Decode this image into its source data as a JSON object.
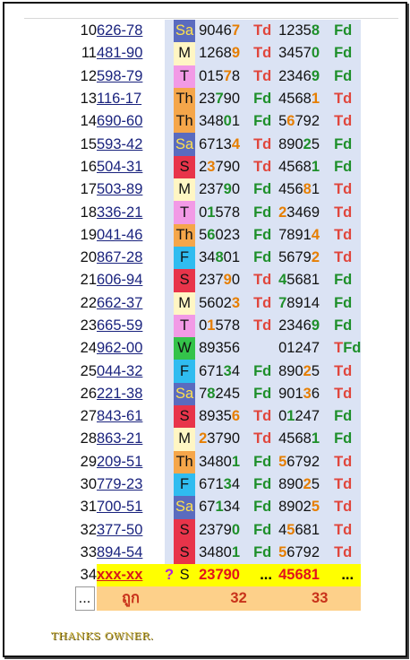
{
  "rows": [
    {
      "no": "10",
      "code": "626-78",
      "day": "Sa",
      "n1": "90467",
      "n1_hl": [
        4
      ],
      "l1": "Td",
      "n2": "12358",
      "n2_hl": [
        4
      ],
      "l2": "Fd"
    },
    {
      "no": "11",
      "code": "481-90",
      "day": "M",
      "n1": "12689",
      "n1_hl": [
        4
      ],
      "l1": "Td",
      "n2": "34570",
      "n2_hl": [
        4
      ],
      "l2": "Fd"
    },
    {
      "no": "12",
      "code": "598-79",
      "day": "T",
      "n1": "01578",
      "n1_hl": [
        3
      ],
      "l1": "Td",
      "n2": "23469",
      "n2_hl": [
        4
      ],
      "l2": "Fd"
    },
    {
      "no": "13",
      "code": "116-17",
      "day": "Th",
      "n1": "23790",
      "n1_hl": [
        2
      ],
      "l1": "Fd",
      "n2": "45681",
      "n2_hl": [
        4
      ],
      "l2": "Td"
    },
    {
      "no": "14",
      "code": "690-60",
      "day": "Th",
      "n1": "34801",
      "n1_hl": [
        3
      ],
      "l1": "Fd",
      "n2": "56792",
      "n2_hl": [
        1
      ],
      "l2": "Td"
    },
    {
      "no": "15",
      "code": "593-42",
      "day": "Sa",
      "n1": "67134",
      "n1_hl": [
        4
      ],
      "l1": "Td",
      "n2": "89025",
      "n2_hl": [
        3
      ],
      "l2": "Fd"
    },
    {
      "no": "16",
      "code": "504-31",
      "day": "S",
      "n1": "23790",
      "n1_hl": [
        1
      ],
      "l1": "Td",
      "n2": "45681",
      "n2_hl": [
        4
      ],
      "l2": "Fd"
    },
    {
      "no": "17",
      "code": "503-89",
      "day": "M",
      "n1": "23790",
      "n1_hl": [
        3
      ],
      "l1": "Fd",
      "n2": "45681",
      "n2_hl": [
        3
      ],
      "l2": "Td"
    },
    {
      "no": "18",
      "code": "336-21",
      "day": "T",
      "n1": "01578",
      "n1_hl": [
        1
      ],
      "l1": "Fd",
      "n2": "23469",
      "n2_hl": [
        0
      ],
      "l2": "Td"
    },
    {
      "no": "19",
      "code": "041-46",
      "day": "Th",
      "n1": "56023",
      "n1_hl": [
        1
      ],
      "l1": "Fd",
      "n2": "78914",
      "n2_hl": [
        4
      ],
      "l2": "Td"
    },
    {
      "no": "20",
      "code": "867-28",
      "day": "F",
      "n1": "34801",
      "n1_hl": [
        2
      ],
      "l1": "Fd",
      "n2": "56792",
      "n2_hl": [
        4
      ],
      "l2": "Td"
    },
    {
      "no": "21",
      "code": "606-94",
      "day": "S",
      "n1": "23790",
      "n1_hl": [
        3
      ],
      "l1": "Td",
      "n2": "45681",
      "n2_hl": [
        0
      ],
      "l2": "Fd"
    },
    {
      "no": "22",
      "code": "662-37",
      "day": "M",
      "n1": "56023",
      "n1_hl": [
        4
      ],
      "l1": "Td",
      "n2": "78914",
      "n2_hl": [
        0
      ],
      "l2": "Fd"
    },
    {
      "no": "23",
      "code": "665-59",
      "day": "T",
      "n1": "01578",
      "n1_hl": [
        1
      ],
      "l1": "Td",
      "n2": "23469",
      "n2_hl": [
        4
      ],
      "l2": "Fd"
    },
    {
      "no": "24",
      "code": "962-00",
      "day": "W",
      "n1": "89356",
      "n1_hl": [],
      "l1": "",
      "n2": "01247",
      "n2_hl": [],
      "l2": "TFd"
    },
    {
      "no": "25",
      "code": "044-32",
      "day": "F",
      "n1": "67134",
      "n1_hl": [
        3
      ],
      "l1": "Fd",
      "n2": "89025",
      "n2_hl": [
        3
      ],
      "l2": "Td"
    },
    {
      "no": "26",
      "code": "221-38",
      "day": "Sa",
      "n1": "78245",
      "n1_hl": [
        1
      ],
      "l1": "Fd",
      "n2": "90136",
      "n2_hl": [
        3
      ],
      "l2": "Td"
    },
    {
      "no": "27",
      "code": "843-61",
      "day": "S",
      "n1": "89356",
      "n1_hl": [
        4
      ],
      "l1": "Td",
      "n2": "01247",
      "n2_hl": [
        1
      ],
      "l2": "Fd"
    },
    {
      "no": "28",
      "code": "863-21",
      "day": "M",
      "n1": "23790",
      "n1_hl": [
        0
      ],
      "l1": "Td",
      "n2": "45681",
      "n2_hl": [
        4
      ],
      "l2": "Fd"
    },
    {
      "no": "29",
      "code": "209-51",
      "day": "Th",
      "n1": "34801",
      "n1_hl": [
        4
      ],
      "l1": "Fd",
      "n2": "56792",
      "n2_hl": [
        0
      ],
      "l2": "Td"
    },
    {
      "no": "30",
      "code": "779-23",
      "day": "F",
      "n1": "67134",
      "n1_hl": [
        3
      ],
      "l1": "Fd",
      "n2": "89025",
      "n2_hl": [
        3
      ],
      "l2": "Td"
    },
    {
      "no": "31",
      "code": "700-51",
      "day": "Sa",
      "n1": "67134",
      "n1_hl": [
        2
      ],
      "l1": "Fd",
      "n2": "89025",
      "n2_hl": [
        4
      ],
      "l2": "Td"
    },
    {
      "no": "32",
      "code": "377-50",
      "day": "S",
      "n1": "23790",
      "n1_hl": [
        4
      ],
      "l1": "Fd",
      "n2": "45681",
      "n2_hl": [
        1
      ],
      "l2": "Td"
    },
    {
      "no": "33",
      "code": "894-54",
      "day": "S",
      "n1": "34801",
      "n1_hl": [
        4
      ],
      "l1": "Fd",
      "n2": "56792",
      "n2_hl": [
        0
      ],
      "l2": "Td"
    }
  ],
  "highlight_row": {
    "no": "34",
    "code": "xxx-xx",
    "mark": "?",
    "day": "S",
    "n1": "23790",
    "l1": "...",
    "n2": "45681",
    "l2": "..."
  },
  "summary_row": {
    "no": "...",
    "label": "ถูก",
    "total1": "32",
    "total2": "33"
  },
  "footer": {
    "thanks": "THANKS OWNER."
  },
  "colors": {
    "highlight_orange": "#e67e00",
    "highlight_green": "#1e8f2a",
    "td_red": "#e0463c",
    "fd_green": "#1e8f2a",
    "row_yellow": "#ffff00"
  }
}
